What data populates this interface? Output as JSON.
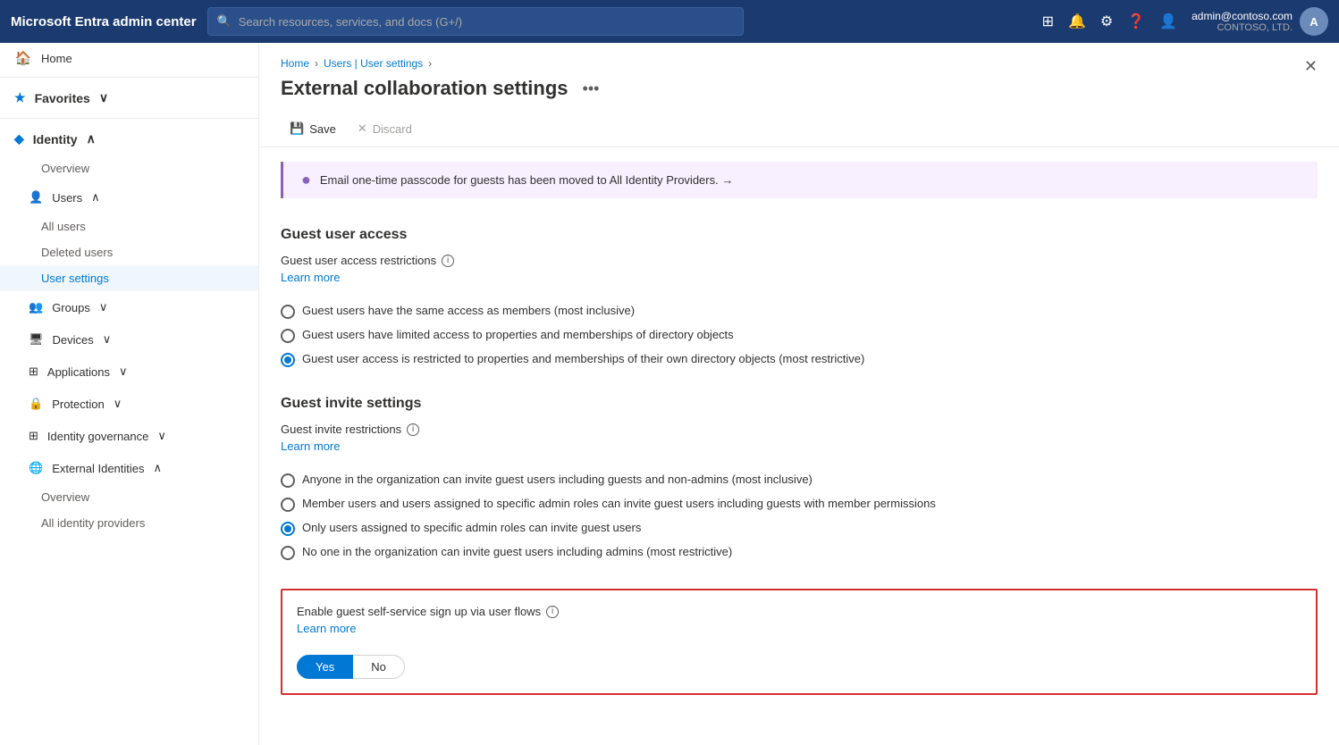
{
  "topNav": {
    "title": "Microsoft Entra admin center",
    "searchPlaceholder": "Search resources, services, and docs (G+/)",
    "userEmail": "admin@contoso.com",
    "userOrg": "CONTOSO, LTD.",
    "userInitials": "A"
  },
  "sidebar": {
    "home": "Home",
    "favorites": "Favorites",
    "identity": "Identity",
    "identityItems": {
      "overview": "Overview",
      "users": "Users",
      "allUsers": "All users",
      "deletedUsers": "Deleted users",
      "userSettings": "User settings",
      "groups": "Groups",
      "devices": "Devices",
      "applications": "Applications",
      "protection": "Protection",
      "identityGovernance": "Identity governance",
      "externalIdentities": "External Identities",
      "externalOverview": "Overview",
      "allIdentityProviders": "All identity providers"
    }
  },
  "breadcrumb": {
    "home": "Home",
    "parent": "Users | User settings"
  },
  "page": {
    "title": "External collaboration settings",
    "toolbar": {
      "save": "Save",
      "discard": "Discard"
    },
    "notice": "Email one-time passcode for guests has been moved to All Identity Providers.  →",
    "guestUserAccess": {
      "sectionTitle": "Guest user access",
      "fieldLabel": "Guest user access restrictions",
      "learnMore": "Learn more",
      "options": [
        "Guest users have the same access as members (most inclusive)",
        "Guest users have limited access to properties and memberships of directory objects",
        "Guest user access is restricted to properties and memberships of their own directory objects (most restrictive)"
      ],
      "selectedIndex": 2
    },
    "guestInviteSettings": {
      "sectionTitle": "Guest invite settings",
      "fieldLabel": "Guest invite restrictions",
      "learnMore": "Learn more",
      "options": [
        "Anyone in the organization can invite guest users including guests and non-admins (most inclusive)",
        "Member users and users assigned to specific admin roles can invite guest users including guests with member permissions",
        "Only users assigned to specific admin roles can invite guest users",
        "No one in the organization can invite guest users including admins (most restrictive)"
      ],
      "selectedIndex": 2
    },
    "selfService": {
      "fieldLabel": "Enable guest self-service sign up via user flows",
      "learnMore": "Learn more",
      "toggleYes": "Yes",
      "toggleNo": "No",
      "selectedToggle": "Yes"
    }
  }
}
